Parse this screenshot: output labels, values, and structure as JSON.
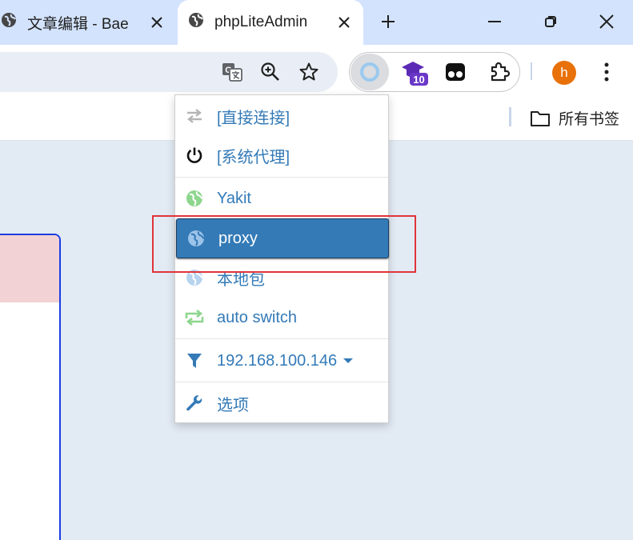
{
  "tabs": [
    {
      "title": "文章编辑 - Bae",
      "icon": "globe-icon",
      "active": false
    },
    {
      "title": "phpLiteAdmin",
      "icon": "globe-icon",
      "active": true
    }
  ],
  "avatar_letter": "h",
  "extension_badge": "10",
  "bookmarks": {
    "all_label": "所有书签"
  },
  "menu": {
    "items": [
      {
        "label": "[直接连接]",
        "icon": "swap-arrows-icon"
      },
      {
        "label": "[系统代理]",
        "icon": "power-icon"
      },
      {
        "label": "Yakit",
        "icon": "globe-icon"
      },
      {
        "label": "proxy",
        "icon": "globe-icon",
        "selected": true
      },
      {
        "label": "本地包",
        "icon": "globe-icon"
      },
      {
        "label": "auto switch",
        "icon": "repeat-icon"
      },
      {
        "label": "192.168.100.146",
        "icon": "filter-icon"
      },
      {
        "label": "选项",
        "icon": "wrench-icon"
      }
    ]
  },
  "colors": {
    "menu_text": "#337ab7",
    "selected_bg": "#337ab7",
    "highlight": "#e0343a",
    "tabstrip": "#d3e3fd"
  }
}
